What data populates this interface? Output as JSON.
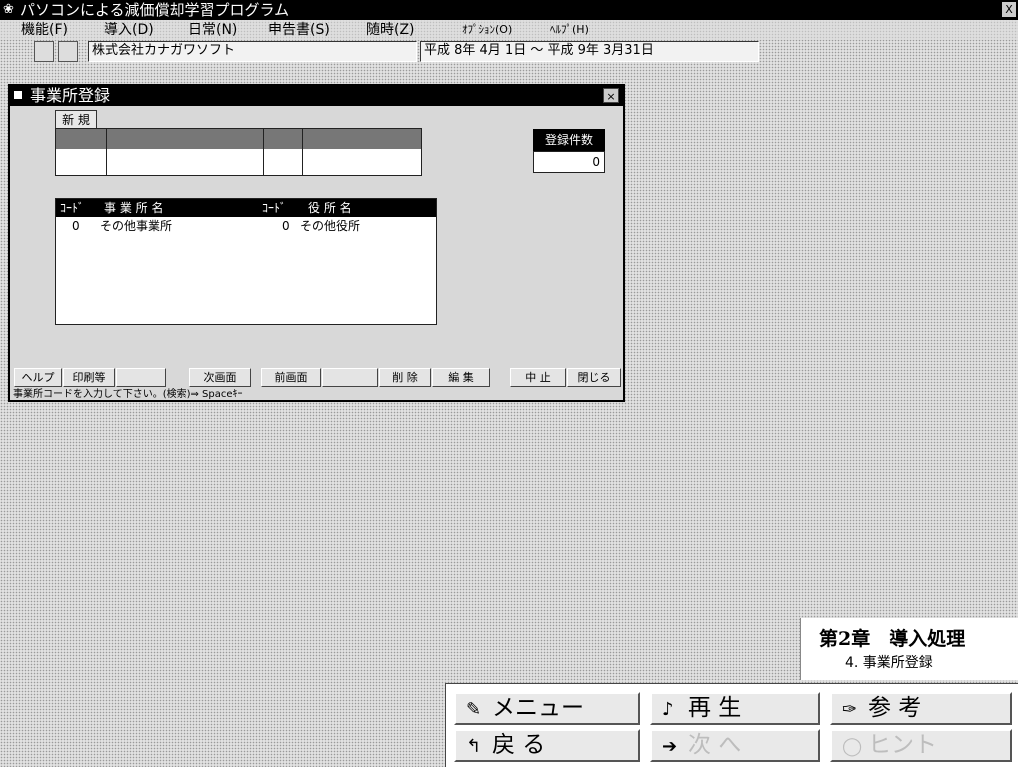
{
  "window": {
    "title": "パソコンによる減価償却学習プログラム",
    "app_icon": "app-icon",
    "close_glyph": "X"
  },
  "menu": {
    "items": [
      "機能(F)",
      "導入(D)",
      "日常(N)",
      "申告書(S)",
      "随時(Z)",
      "ｵﾌﾟｼｮﾝ(O)",
      "ﾍﾙﾌﾟ(H)"
    ]
  },
  "infobar": {
    "company": "株式会社カナガワソフト",
    "period": "平成 8年 4月 1日 ～ 平成 9年 3月31日"
  },
  "dialog": {
    "title": "事業所登録",
    "close_glyph": "×",
    "tab_new": "新 規",
    "count_label": "登録件数",
    "count_value": "0",
    "list_headers": [
      "ｺｰﾄﾞ",
      "事 業 所 名",
      "ｺｰﾄﾞ",
      "役 所 名"
    ],
    "rows": [
      {
        "code": "0",
        "office": "その他事業所",
        "gov_code": "0",
        "gov_office": "その他役所"
      }
    ],
    "fkeys": [
      "ヘルプ",
      "印刷等",
      "",
      "次画面",
      "前画面",
      "",
      "削 除",
      "編 集",
      "中 止",
      "閉じる"
    ],
    "status": "事業所コードを入力して下さい。(検索)⇒ Spaceｷｰ"
  },
  "chapter": {
    "title": "第2章　導入処理",
    "subtitle": "4. 事業所登録"
  },
  "nav": {
    "menu": {
      "label": "メニュー",
      "icon": "menu-icon",
      "glyph": "✎"
    },
    "play": {
      "label": "再 生",
      "icon": "play-icon",
      "glyph": "♪"
    },
    "ref": {
      "label": "参 考",
      "icon": "reference-icon",
      "glyph": "✑"
    },
    "back": {
      "label": "戻 る",
      "icon": "back-arrow-icon",
      "glyph": "↰"
    },
    "next": {
      "label": "次 へ",
      "icon": "next-arrow-icon",
      "glyph": "➔"
    },
    "hint": {
      "label": "ヒント",
      "icon": "hint-icon",
      "glyph": "◯"
    }
  }
}
